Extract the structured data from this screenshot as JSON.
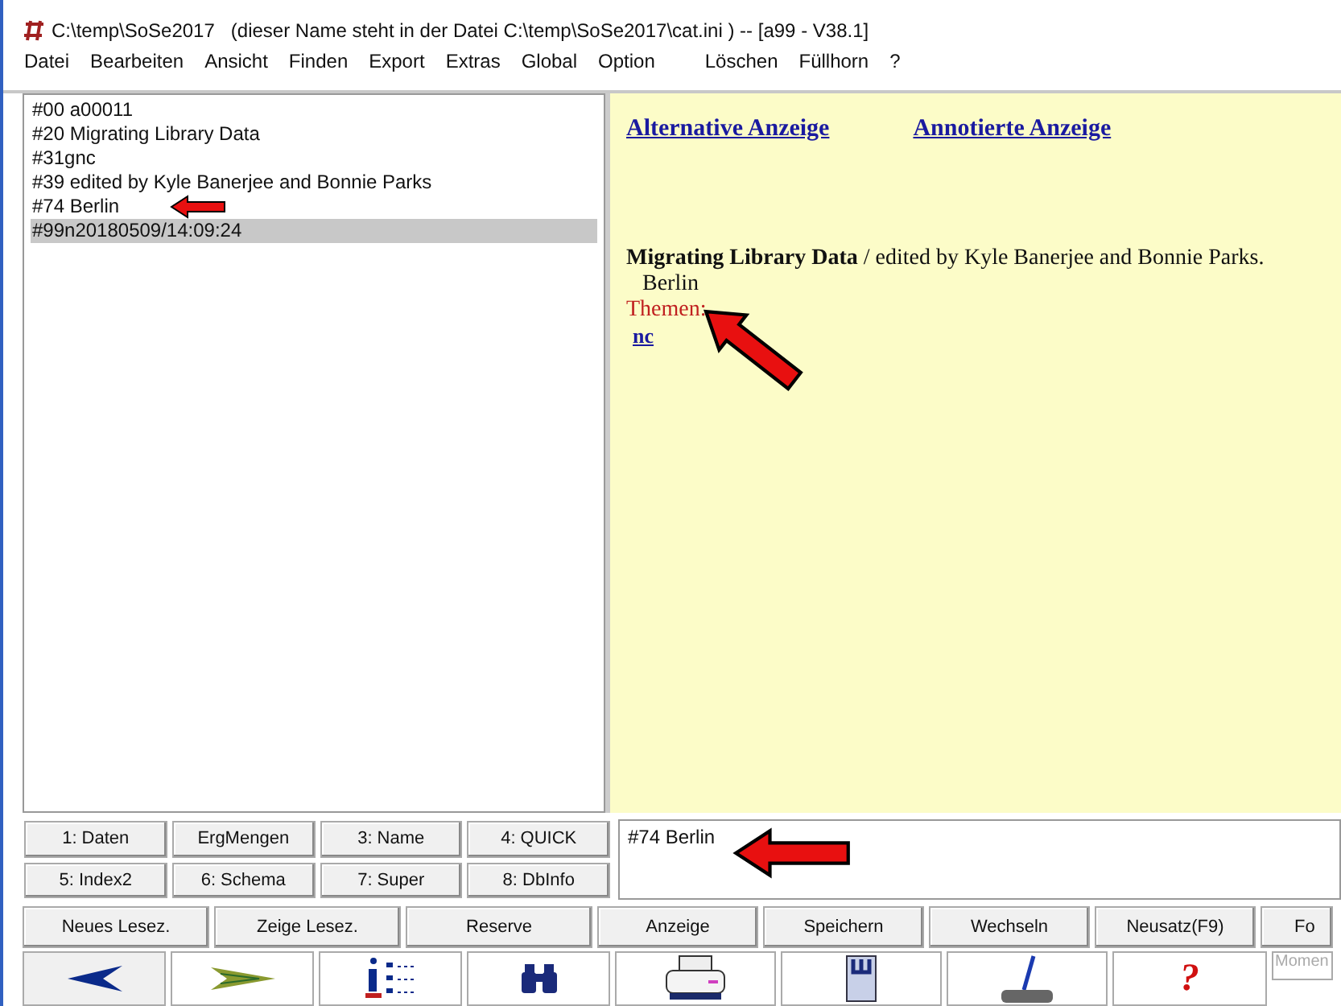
{
  "window": {
    "title": "C:\\temp\\SoSe2017   (dieser Name steht in der Datei C:\\temp\\SoSe2017\\cat.ini ) -- [a99 - V38.1]"
  },
  "menu": [
    "Datei",
    "Bearbeiten",
    "Ansicht",
    "Finden",
    "Export",
    "Extras",
    "Global",
    "Option",
    "Löschen",
    "Füllhorn",
    "?"
  ],
  "record_lines": [
    {
      "text": "#00 a00011",
      "selected": false,
      "arrow": false
    },
    {
      "text": "#20 Migrating Library Data",
      "selected": false,
      "arrow": false
    },
    {
      "text": "#31gnc",
      "selected": false,
      "arrow": false
    },
    {
      "text": "#39 edited by Kyle Banerjee and Bonnie Parks",
      "selected": false,
      "arrow": false
    },
    {
      "text": "#74 Berlin",
      "selected": false,
      "arrow": true
    },
    {
      "text": "#99n20180509/14:09:24",
      "selected": true,
      "arrow": false
    }
  ],
  "display": {
    "links": [
      "Alternative Anzeige",
      "Annotierte Anzeige"
    ],
    "title_line": "**Migrating Library Data** / edited by Kyle Banerjee and Bonnie Parks.",
    "place": "Berlin",
    "subjects_label": "Themen:",
    "subjects_arrow": true,
    "link_nc": "nc"
  },
  "index_buttons": [
    "1: Daten",
    "ErgMengen",
    "3: Name",
    "4: QUICK",
    "5: Index2",
    "6: Schema",
    "7: Super",
    "8: DbInfo"
  ],
  "command_field": {
    "value": "#74 Berlin",
    "arrow": true
  },
  "action_buttons": [
    "Neues Lesez.",
    "Zeige Lesez.",
    "Reserve",
    "Anzeige",
    "Speichern",
    "Wechseln",
    "Neusatz(F9)",
    "Fo"
  ],
  "toolbar": [
    {
      "kind": "back"
    },
    {
      "kind": "forward"
    },
    {
      "kind": "info"
    },
    {
      "kind": "binoculars"
    },
    {
      "kind": "printer"
    },
    {
      "kind": "document"
    },
    {
      "kind": "broom"
    },
    {
      "kind": "text",
      "label": "?"
    }
  ],
  "status_field": {
    "placeholder": "Momen"
  }
}
